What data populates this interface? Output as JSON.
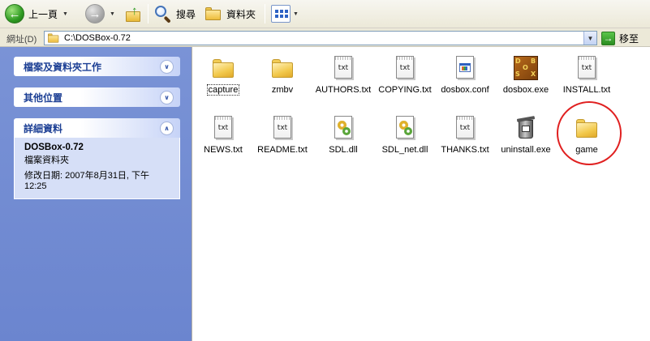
{
  "toolbar": {
    "back_label": "上一頁",
    "search_label": "搜尋",
    "folders_label": "資料夾"
  },
  "address": {
    "label": "網址(D)",
    "value": "C:\\DOSBox-0.72",
    "go_label": "移至"
  },
  "taskpane": {
    "file_tasks_title": "檔案及資料夾工作",
    "other_places_title": "其他位置",
    "details_title": "詳細資料",
    "details": {
      "name": "DOSBox-0.72",
      "type": "檔案資料夾",
      "date_line1": "修改日期: 2007年8月31日, 下午",
      "date_line2": "12:25"
    }
  },
  "files": [
    {
      "name": "capture",
      "icon": "folder-icon",
      "selected": true
    },
    {
      "name": "zmbv",
      "icon": "folder-icon"
    },
    {
      "name": "AUTHORS.txt",
      "icon": "text-file-icon",
      "badge": "txt"
    },
    {
      "name": "COPYING.txt",
      "icon": "text-file-icon",
      "badge": "txt"
    },
    {
      "name": "dosbox.conf",
      "icon": "config-file-icon"
    },
    {
      "name": "dosbox.exe",
      "icon": "dosbox-app-icon",
      "badge": "DOS"
    },
    {
      "name": "INSTALL.txt",
      "icon": "text-file-icon",
      "badge": "txt"
    },
    {
      "name": "NEWS.txt",
      "icon": "text-file-icon",
      "badge": "txt"
    },
    {
      "name": "README.txt",
      "icon": "text-file-icon",
      "badge": "txt"
    },
    {
      "name": "SDL.dll",
      "icon": "dll-file-icon"
    },
    {
      "name": "SDL_net.dll",
      "icon": "dll-file-icon"
    },
    {
      "name": "THANKS.txt",
      "icon": "text-file-icon",
      "badge": "txt"
    },
    {
      "name": "uninstall.exe",
      "icon": "uninstall-icon"
    },
    {
      "name": "game",
      "icon": "folder-icon"
    }
  ],
  "colors": {
    "taskpane_bg": "#7a93d6",
    "highlight_ring": "#e02020"
  }
}
